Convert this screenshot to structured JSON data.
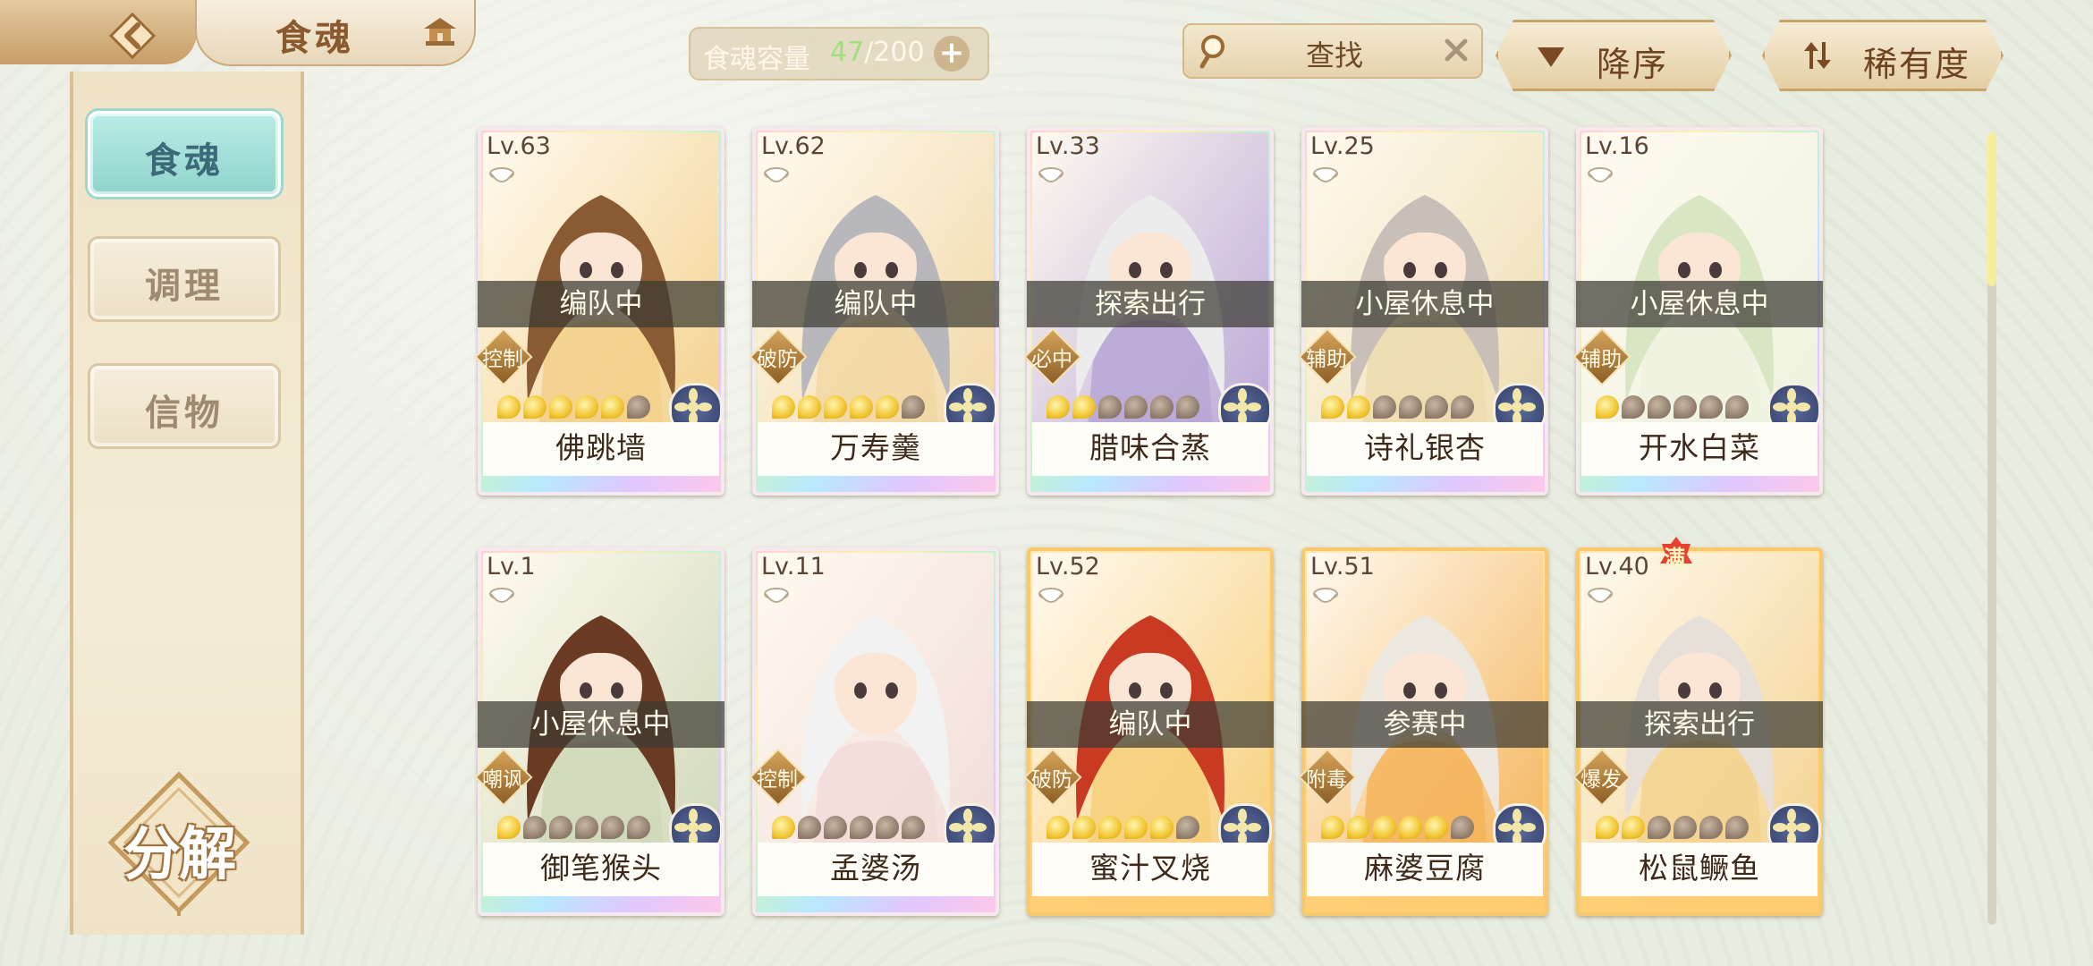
{
  "header": {
    "title": "食魂",
    "capacity": {
      "label": "食魂容量",
      "current": "47",
      "max": "/200",
      "add_label": "+"
    },
    "search": {
      "label": "查找"
    },
    "sort_label": "降序",
    "rarity_label": "稀有度"
  },
  "sidebar": {
    "tabs": [
      {
        "label": "食魂",
        "active": true
      },
      {
        "label": "调理",
        "active": false
      },
      {
        "label": "信物",
        "active": false
      }
    ],
    "decompose_label": "分解"
  },
  "cards": [
    {
      "level": "Lv.63",
      "status": "编队中",
      "role": "控制",
      "name": "佛跳墙",
      "stars": 5,
      "star_max": 6,
      "frame": "rainbow",
      "hair": "#8a5a33",
      "bg": "#f3d08a"
    },
    {
      "level": "Lv.62",
      "status": "编队中",
      "role": "破防",
      "name": "万寿羹",
      "stars": 5,
      "star_max": 6,
      "frame": "rainbow",
      "hair": "#b8b8bc",
      "bg": "#f1d7a3"
    },
    {
      "level": "Lv.33",
      "status": "探索出行",
      "role": "必中",
      "name": "腊味合蒸",
      "stars": 2,
      "star_max": 6,
      "frame": "rainbow",
      "hair": "#ececec",
      "bg": "#b8a6d6"
    },
    {
      "level": "Lv.25",
      "status": "小屋休息中",
      "role": "辅助",
      "name": "诗礼银杏",
      "stars": 2,
      "star_max": 6,
      "frame": "rainbow",
      "hair": "#c8c0b8",
      "bg": "#ecdcae"
    },
    {
      "level": "Lv.16",
      "status": "小屋休息中",
      "role": "辅助",
      "name": "开水白菜",
      "stars": 1,
      "star_max": 6,
      "frame": "rainbow",
      "hair": "#d8e6c4",
      "bg": "#eef2e0"
    },
    {
      "level": "Lv.1",
      "status": "小屋休息中",
      "role": "嘲讽",
      "name": "御笔猴头",
      "stars": 1,
      "star_max": 6,
      "frame": "rainbow",
      "hair": "#6b3a22",
      "bg": "#cfd8b8"
    },
    {
      "level": "Lv.11",
      "status": "",
      "role": "控制",
      "name": "孟婆汤",
      "stars": 1,
      "star_max": 6,
      "frame": "rainbow",
      "hair": "#f2f2f2",
      "bg": "#f1dcd8"
    },
    {
      "level": "Lv.52",
      "status": "编队中",
      "role": "破防",
      "name": "蜜汁叉烧",
      "stars": 5,
      "star_max": 6,
      "frame": "gold",
      "hair": "#c93a22",
      "bg": "#f7cf7a"
    },
    {
      "level": "Lv.51",
      "status": "参赛中",
      "role": "附毒",
      "name": "麻婆豆腐",
      "stars": 5,
      "star_max": 6,
      "frame": "gold",
      "hair": "#ece8e0",
      "bg": "#f4b45a"
    },
    {
      "level": "Lv.40",
      "status": "探索出行",
      "role": "爆发",
      "name": "松鼠鳜鱼",
      "stars": 2,
      "star_max": 6,
      "frame": "gold",
      "hair": "#e6e0d8",
      "bg": "#f3d28e",
      "full_badge": "满"
    }
  ]
}
